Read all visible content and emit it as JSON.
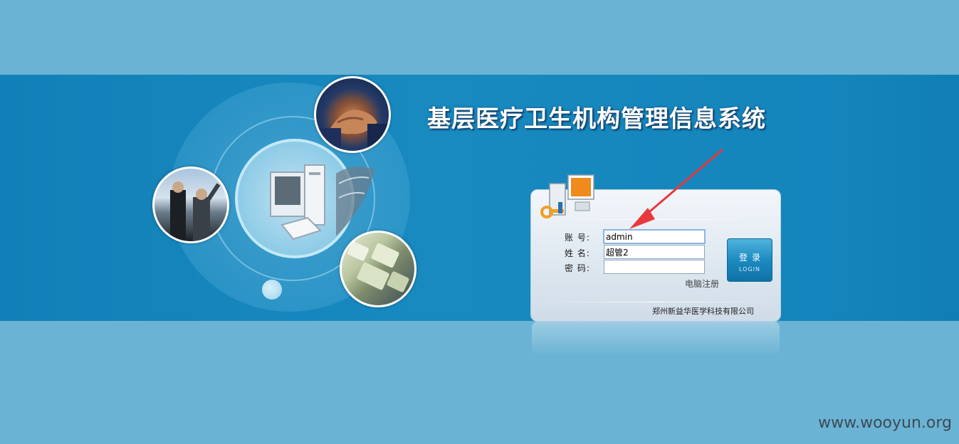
{
  "title": "基层医疗卫生机构管理信息系统",
  "login": {
    "account_label": "账  号:",
    "account_value": "admin",
    "name_label": "姓  名:",
    "name_value": "超管2",
    "password_label": "密  码:",
    "password_value": "",
    "button_label_cn": "登录",
    "button_label_en": "LOGIN",
    "register_label": "电脑注册",
    "company": "郑州新益华医学科技有限公司"
  },
  "watermark": "www.wooyun.org",
  "colors": {
    "page_bg": "#6ab3d4",
    "band": "#1383ba",
    "arrow": "#e8383d",
    "button": "#1d8ac0"
  },
  "icons": [
    "handshake-photo",
    "businessmen-photo",
    "keyboard-photo",
    "computer-icon",
    "key-computer-icon",
    "red-arrow"
  ]
}
